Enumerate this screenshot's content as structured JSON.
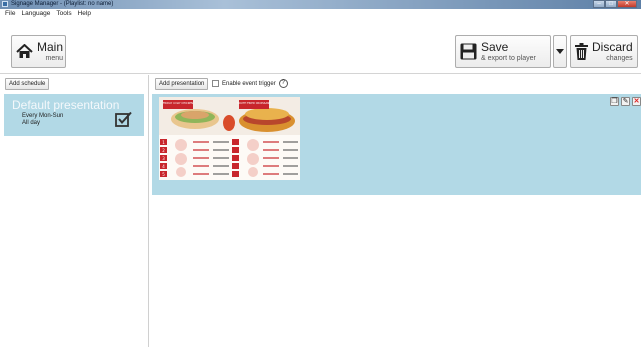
{
  "window": {
    "title": "Signage Manager - (Playlist: no name)",
    "controls": {
      "minimize": "–",
      "maximize": "□",
      "close": "✕"
    }
  },
  "menu": [
    "File",
    "Language",
    "Tools",
    "Help"
  ],
  "toolbar": {
    "main": {
      "big": "Main",
      "small": "menu",
      "icon": "home-icon"
    },
    "save": {
      "big": "Save",
      "small": "& export to player",
      "icon": "floppy-disk-icon"
    },
    "save_dropdown": {
      "icon": "caret-down-icon"
    },
    "discard": {
      "big": "Discard",
      "small": "changes",
      "icon": "trash-icon"
    }
  },
  "schedules": {
    "add_label": "Add schedule",
    "items": [
      {
        "title": "Default presentation",
        "days": "Every Mon-Sun",
        "time": "All day",
        "checked": true
      }
    ]
  },
  "presentations": {
    "add_label": "Add presentation",
    "event_trigger_label": "Enable event trigger",
    "event_trigger_checked": false,
    "help": "?",
    "items": [
      {
        "thumbnail": {
          "left_banner": "FRIDAY 4 DAY CHICKEN",
          "right_banner": "SOUTH FRIED CROISSANT",
          "item_numbers": [
            "1",
            "2",
            "3",
            "4",
            "5"
          ]
        },
        "action_icons": [
          "copy-icon",
          "edit-icon",
          "delete-icon"
        ]
      }
    ]
  },
  "colors": {
    "selection": "#b2d9e6",
    "thumb_red": "#c8262c"
  }
}
